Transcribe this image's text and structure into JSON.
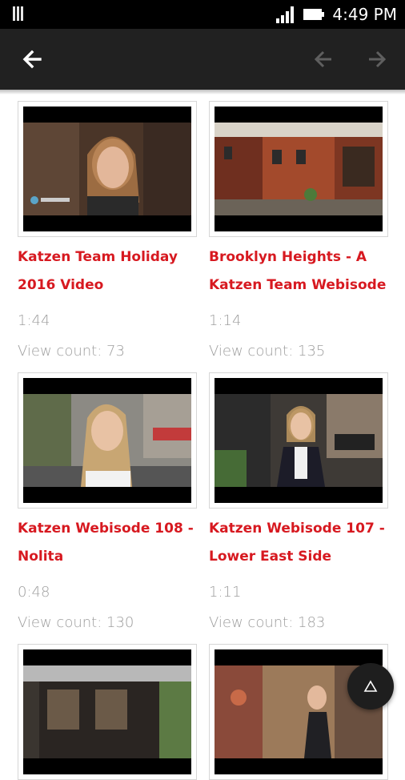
{
  "status_bar": {
    "time": "4:49 PM"
  },
  "toolbar": {
    "back_icon": "arrow-back-icon",
    "prev_icon": "arrow-left-icon",
    "next_icon": "arrow-right-icon"
  },
  "videos": [
    {
      "title_line1": "Katzen Team Holiday",
      "title_line2": "2016 Video",
      "duration": "1:44",
      "views": "View count: 73"
    },
    {
      "title_line1": "Brooklyn Heights - A",
      "title_line2": "Katzen Team Webisode",
      "duration": "1:14",
      "views": "View count: 135"
    },
    {
      "title_line1": "Katzen Webisode 108 -",
      "title_line2": "Nolita",
      "duration": "0:48",
      "views": "View count: 130"
    },
    {
      "title_line1": "Katzen Webisode 107 -",
      "title_line2": "Lower East Side",
      "duration": "1:11",
      "views": "View count: 183"
    },
    {
      "title_line1": "",
      "title_line2": "",
      "duration": "",
      "views": ""
    },
    {
      "title_line1": "",
      "title_line2": "",
      "duration": "",
      "views": ""
    }
  ],
  "fab": {
    "icon": "scroll-to-top-icon"
  }
}
